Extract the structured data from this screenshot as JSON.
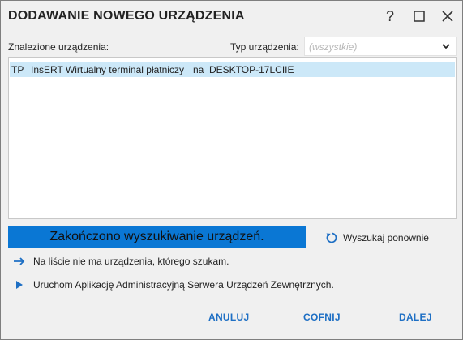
{
  "window": {
    "title": "DODAWANIE NOWEGO URZĄDZENIA",
    "help_label": "?"
  },
  "filters": {
    "found_label": "Znalezione urządzenia:",
    "type_label": "Typ urządzenia:",
    "type_value": "(wszystkie)"
  },
  "devices": [
    {
      "code": "TP",
      "name": "InsERT Wirtualny terminal płatniczy",
      "connector": "na",
      "host": "DESKTOP-17LCIIE"
    }
  ],
  "status": {
    "text": "Zakończono wyszukiwanie urządzeń.",
    "color": "#0a77d4"
  },
  "actions": {
    "search_again": "Wyszukaj ponownie",
    "missing_device": "Na liście nie ma urządzenia, którego szukam.",
    "launch_admin": "Uruchom Aplikację Administracyjną Serwera Urządzeń Zewnętrznych."
  },
  "footer": {
    "cancel": "ANULUJ",
    "back": "COFNIJ",
    "next": "DALEJ"
  }
}
